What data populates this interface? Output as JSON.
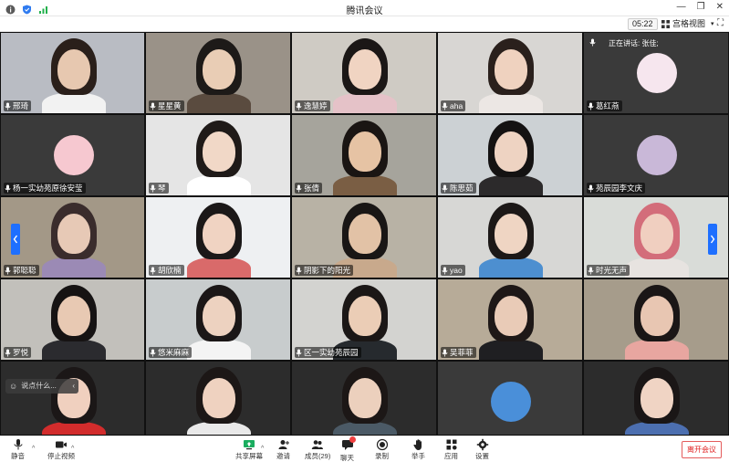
{
  "window": {
    "title": "腾讯会议"
  },
  "infobar": {
    "time": "05:22",
    "view_label": "宫格视图"
  },
  "speaking": {
    "label": "正在讲话: 张佳;"
  },
  "tiles": [
    {
      "name": "邢琦",
      "kind": "video",
      "bg": "#b9bcc3",
      "skin": "#e7c8b0",
      "hair": "#2a1f1a",
      "cloth": "#f2f2f2"
    },
    {
      "name": "星星黄",
      "kind": "video",
      "bg": "#9a9288",
      "skin": "#e9cdb5",
      "hair": "#1d1a18",
      "cloth": "#5a4b3f"
    },
    {
      "name": "逸慧婷",
      "kind": "video",
      "bg": "#cfcbc4",
      "skin": "#f0d4c2",
      "hair": "#1b1716",
      "cloth": "#e5c2c8"
    },
    {
      "name": "aha",
      "kind": "video",
      "bg": "#d8d6d3",
      "skin": "#efd2bf",
      "hair": "#2a201c",
      "cloth": "#ece7e4"
    },
    {
      "name": "葛红燕",
      "kind": "avatar",
      "bg": "#3a3a3a",
      "avatar": "#f6e6ee"
    },
    {
      "name": "杨一实幼苑原徐安莹",
      "kind": "avatar",
      "bg": "#3a3a3a",
      "avatar": "#f6c8d0"
    },
    {
      "name": "琴",
      "kind": "video",
      "bg": "#e5e5e5",
      "skin": "#f1d8c7",
      "hair": "#1f1a18",
      "cloth": "#ffffff"
    },
    {
      "name": "张倩",
      "kind": "video",
      "bg": "#a6a49c",
      "skin": "#e6c3a4",
      "hair": "#1a1513",
      "cloth": "#7a5e44"
    },
    {
      "name": "陈思茹",
      "kind": "video",
      "bg": "#ccd1d4",
      "skin": "#eed3c2",
      "hair": "#141212",
      "cloth": "#2c2a2b"
    },
    {
      "name": "苑辰园李文庆",
      "kind": "avatar",
      "bg": "#3a3a3a",
      "avatar": "#c9b8d8"
    },
    {
      "name": "郭聪聪",
      "kind": "video",
      "bg": "#a39887",
      "skin": "#e7c9b6",
      "hair": "#3a2c2c",
      "cloth": "#9b8ab5"
    },
    {
      "name": "胡欣楠",
      "kind": "video",
      "bg": "#eef0f2",
      "skin": "#f0d3c2",
      "hair": "#1b1818",
      "cloth": "#d96a6a"
    },
    {
      "name": "阴影下的阳光",
      "kind": "video",
      "bg": "#b8b2a5",
      "skin": "#e2c2a6",
      "hair": "#191615",
      "cloth": "#c8a98c"
    },
    {
      "name": "yao",
      "kind": "video",
      "bg": "#d7d7d5",
      "skin": "#efd5c3",
      "hair": "#1c1817",
      "cloth": "#4d8fd0"
    },
    {
      "name": "时光无声",
      "kind": "video",
      "bg": "#d9dcd8",
      "skin": "#f0cfc0",
      "hair": "#d36d7a",
      "cloth": "#e7e3e0"
    },
    {
      "name": "罗悦",
      "kind": "video",
      "bg": "#c2c0bb",
      "skin": "#e8c9b3",
      "hair": "#161313",
      "cloth": "#2b2b2f"
    },
    {
      "name": "悠米麻麻",
      "kind": "video",
      "bg": "#c8cccd",
      "skin": "#edd2c0",
      "hair": "#1b1717",
      "cloth": "#f4f4f4"
    },
    {
      "name": "区一实幼苑辰园",
      "kind": "video",
      "bg": "#d3d3d0",
      "skin": "#ebcdb6",
      "hair": "#1b1716",
      "cloth": "#262a2e"
    },
    {
      "name": "吴菲菲",
      "kind": "video",
      "bg": "#b7ab98",
      "skin": "#e9cbb7",
      "hair": "#1e1817",
      "cloth": "#1f1f22"
    },
    {
      "name": "",
      "kind": "video",
      "bg": "#a69c8b",
      "skin": "#e8c6b2",
      "hair": "#1a1616",
      "cloth": "#e8a6a0"
    },
    {
      "name": "",
      "kind": "video",
      "bg": "#2c2c2c",
      "skin": "#f0d0bf",
      "hair": "#1b1717",
      "cloth": "#d22c2c"
    },
    {
      "name": "",
      "kind": "video",
      "bg": "#2c2c2c",
      "skin": "#efd2c0",
      "hair": "#1c1716",
      "cloth": "#e9e9e9"
    },
    {
      "name": "",
      "kind": "video",
      "bg": "#2c2c2c",
      "skin": "#ecd0bd",
      "hair": "#1c1716",
      "cloth": "#4b5a66"
    },
    {
      "name": "",
      "kind": "avatar",
      "bg": "#3a3a3a",
      "avatar": "#4a8fd9"
    },
    {
      "name": "",
      "kind": "video",
      "bg": "#2c2c2c",
      "skin": "#f0d4c4",
      "hair": "#1a1616",
      "cloth": "#4c6fb0"
    }
  ],
  "chat_hint": "说点什么...",
  "toolbar": {
    "mute": "静音",
    "stop_video": "停止视频",
    "share": "共享屏幕",
    "invite": "邀请",
    "members": "成员(29)",
    "chat": "聊天",
    "record": "录制",
    "hand": "举手",
    "apps": "应用",
    "settings": "设置",
    "leave": "离开会议"
  },
  "colors": {
    "accent": "#1e6fff",
    "danger": "#e02020"
  }
}
